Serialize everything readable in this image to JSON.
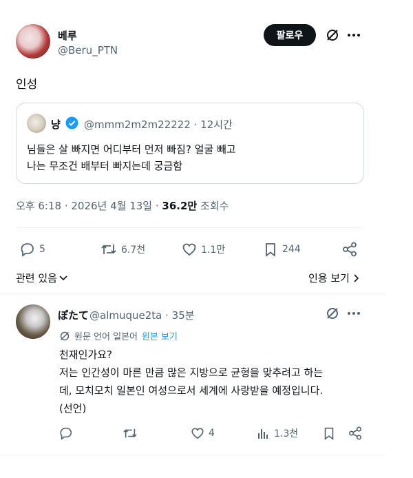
{
  "post": {
    "author_name": "베루",
    "author_handle": "@Beru_PTN",
    "follow_label": "팔로우",
    "text": "인성",
    "quote": {
      "name": "냥",
      "handle_time": "@mmm2m2m22222 · 12시간",
      "line1": "님들은 살 빠지면 어디부터 먼저 빠짐? 얼굴 빼고",
      "line2": "나는 무조건 배부터 빠지는데 궁금함"
    },
    "meta_time": "오후 6:18 · 2026년 4월 13일 ·",
    "views_count": "36.2만",
    "views_label": "조회수",
    "actions": {
      "replies": "5",
      "retweets": "6.7천",
      "likes": "1.1만",
      "bookmarks": "244"
    },
    "related_label": "관련 있음",
    "quote_tweets_label": "인용 보기"
  },
  "reply": {
    "name": "ぽたて",
    "handle_time": "@almuque2ta · 35분",
    "translate_note": "원문 언어 일본어",
    "translate_link": "원본 보기",
    "line1": "천재인가요?",
    "line2": "저는 인간성이 마른 만큼 많은 지방으로 균형을 맞추려고 하는",
    "line3": "데, 모치모치 일본인 여성으로서 세계에 사랑받을 예정입니다.",
    "line4": "(선언)",
    "actions": {
      "likes": "4",
      "views": "1.3천"
    }
  },
  "icons": [
    "grok-slash-icon",
    "more-icon",
    "verified-icon",
    "reply-icon",
    "retweet-icon",
    "like-icon",
    "bookmark-icon",
    "share-icon",
    "chevron-down-icon",
    "chevron-right-icon",
    "translate-icon",
    "analytics-icon"
  ],
  "colors": {
    "accent": "#1d9bf0",
    "text": "#0f1419",
    "muted": "#536471",
    "button": "#0f1419"
  }
}
